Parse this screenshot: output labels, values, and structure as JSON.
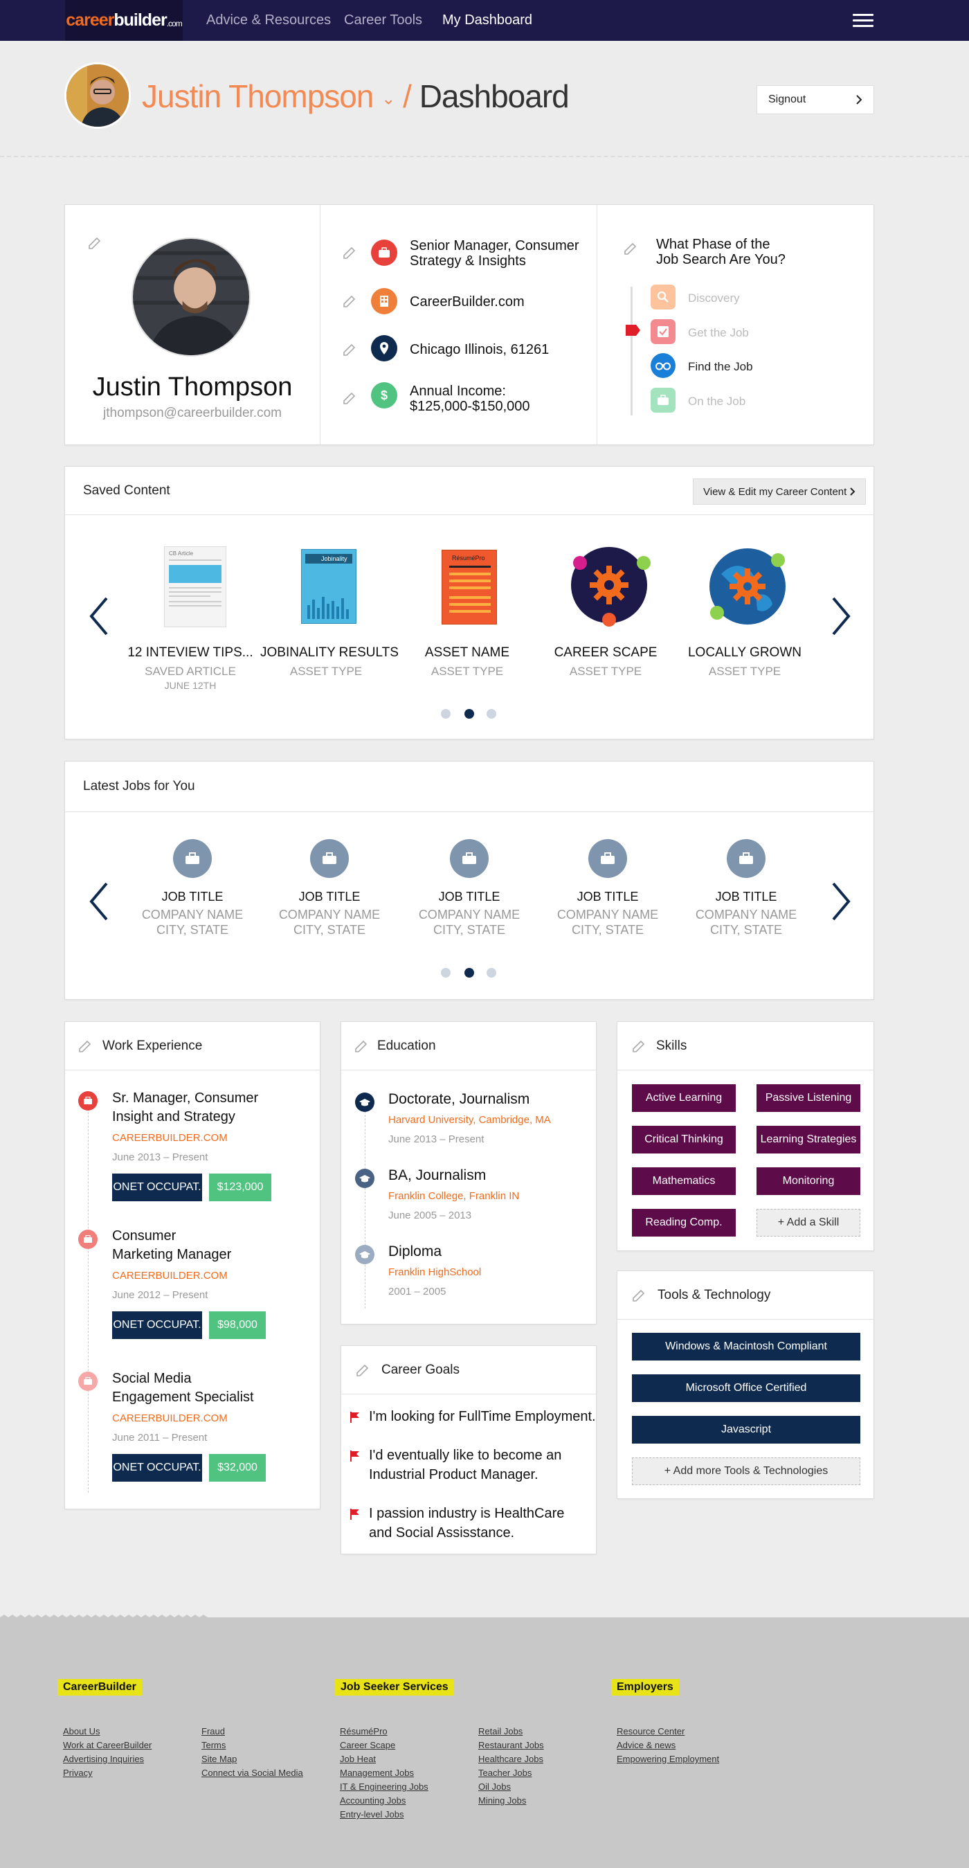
{
  "nav": {
    "logo_a": "career",
    "logo_b": "builder",
    "logo_c": ".com",
    "links": [
      "Advice & Resources",
      "Career Tools",
      "My Dashboard"
    ]
  },
  "header": {
    "user_name": "Justin Thompson",
    "dropdown": "⌄",
    "separator": " / ",
    "page": "Dashboard",
    "signout": "Signout"
  },
  "profile": {
    "name": "Justin Thompson",
    "email": "jthompson@careerbuilder.com",
    "title_line1": "Senior Manager, Consumer",
    "title_line2": "Strategy & Insights",
    "company": "CareerBuilder.com",
    "location": "Chicago Illinois, 61261",
    "income_line1": "Annual Income:",
    "income_line2": "$125,000-$150,000",
    "phase_q1": "What Phase of the",
    "phase_q2": "Job Search Are You?",
    "phases": [
      "Discovery",
      "Get the Job",
      "Find the Job",
      "On the Job"
    ],
    "colors": {
      "red": "#e8403b",
      "orange": "#f07f3a",
      "navy": "#0e2a4e",
      "green": "#4fc37f"
    }
  },
  "saved": {
    "title": "Saved Content",
    "edit_button": "View & Edit my Career Content",
    "items": [
      {
        "title": "12 INTEVIEW TIPS...",
        "sub": "SAVED ARTICLE",
        "date": "JUNE 12TH"
      },
      {
        "title": "JOBINALITY RESULTS",
        "sub": "ASSET TYPE"
      },
      {
        "title": "ASSET NAME",
        "sub": "ASSET TYPE"
      },
      {
        "title": "CAREER SCAPE",
        "sub": "ASSET TYPE"
      },
      {
        "title": "LOCALLY GROWN",
        "sub": "ASSET TYPE"
      }
    ],
    "thumb_labels": {
      "article": "CB Article",
      "jobinality": "Jobinality",
      "resume": "RésuméPro"
    }
  },
  "jobs": {
    "title": "Latest Jobs for You",
    "items": [
      {
        "title": "JOB TITLE",
        "company": "COMPANY NAME",
        "loc": "CITY, STATE"
      },
      {
        "title": "JOB TITLE",
        "company": "COMPANY NAME",
        "loc": "CITY, STATE"
      },
      {
        "title": "JOB TITLE",
        "company": "COMPANY NAME",
        "loc": "CITY, STATE"
      },
      {
        "title": "JOB TITLE",
        "company": "COMPANY NAME",
        "loc": "CITY, STATE"
      },
      {
        "title": "JOB TITLE",
        "company": "COMPANY NAME",
        "loc": "CITY, STATE"
      }
    ]
  },
  "work": {
    "title": "Work Experience",
    "items": [
      {
        "l1": "Sr. Manager, Consumer",
        "l2": "Insight and Strategy",
        "company": "CAREERBUILDER.COM",
        "dates": "June 2013 – Present",
        "onet": "ONET OCCUPAT.",
        "salary": "$123,000"
      },
      {
        "l1": "Consumer",
        "l2": "Marketing Manager",
        "company": "CAREERBUILDER.COM",
        "dates": "June 2012 – Present",
        "onet": "ONET OCCUPAT.",
        "salary": "$98,000"
      },
      {
        "l1": "Social Media",
        "l2": "Engagement Specialist",
        "company": "CAREERBUILDER.COM",
        "dates": "June 2011 – Present",
        "onet": "ONET OCCUPAT.",
        "salary": "$32,000"
      }
    ]
  },
  "education": {
    "title": "Education",
    "items": [
      {
        "degree": "Doctorate, Journalism",
        "school": "Harvard University, Cambridge, MA",
        "dates": "June 2013 – Present"
      },
      {
        "degree": "BA, Journalism",
        "school": "Franklin College, Franklin IN",
        "dates": "June 2005 – 2013"
      },
      {
        "degree": "Diploma",
        "school": "Franklin HighSchool",
        "dates": "2001 – 2005"
      }
    ]
  },
  "goals": {
    "title": "Career Goals",
    "items": [
      {
        "l1": "I'm looking for FullTime Employment.",
        "l2": ""
      },
      {
        "l1": "I'd eventually like to become an",
        "l2": "Industrial Product Manager."
      },
      {
        "l1": "I passion industry is HealthCare",
        "l2": "and Social Assisstance."
      }
    ]
  },
  "skills": {
    "title": "Skills",
    "items": [
      "Active Learning",
      "Passive Listening",
      "Critical Thinking",
      "Learning Strategies",
      "Mathematics",
      "Monitoring",
      "Reading Comp."
    ],
    "add": "+ Add a Skill"
  },
  "tools": {
    "title": "Tools & Technology",
    "items": [
      "Windows & Macintosh Compliant",
      "Microsoft Office Certified",
      "Javascript"
    ],
    "add": "+ Add more Tools & Technologies"
  },
  "footer": {
    "headings": [
      "CareerBuilder",
      "Job Seeker Services",
      "Employers"
    ],
    "col1": [
      "About Us",
      "Work at CareerBuilder",
      "Advertising Inquiries",
      "Privacy"
    ],
    "col2": [
      "Fraud",
      "Terms",
      "Site Map",
      "Connect via Social Media"
    ],
    "col3": [
      "RésuméPro",
      "Career Scape",
      "Job Heat",
      "Management Jobs",
      "IT & Engineering Jobs",
      "Accounting Jobs",
      "Entry-level Jobs"
    ],
    "col4": [
      "Retail Jobs",
      "Restaurant Jobs",
      "Healthcare Jobs",
      "Teacher Jobs",
      "Oil Jobs",
      "Mining Jobs"
    ],
    "col5": [
      "Resource Center",
      "Advice & news",
      "Empowering Employment"
    ]
  }
}
